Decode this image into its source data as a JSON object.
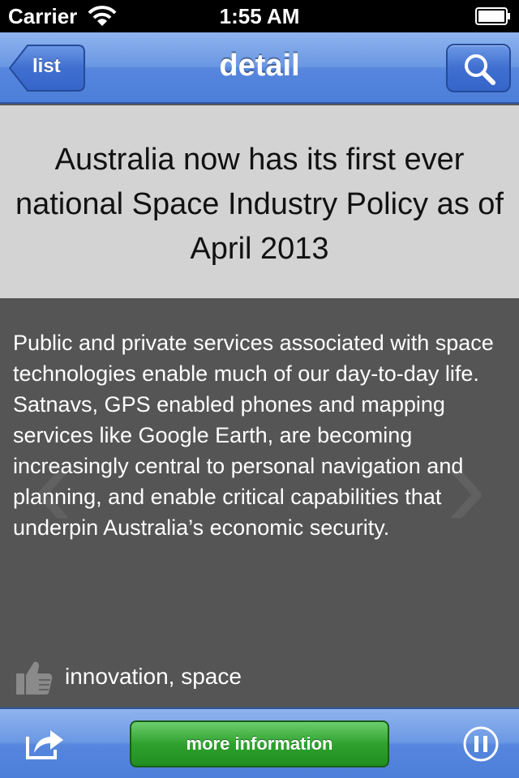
{
  "status_bar": {
    "carrier": "Carrier",
    "time": "1:55 AM"
  },
  "nav_bar": {
    "back_label": "list",
    "title": "detail",
    "search_icon": "search-icon"
  },
  "article": {
    "title": "Australia now has its first ever national Space Industry Policy as of April 2013",
    "body": "Public and private services associated with space technologies enable much of our day-to-day life. Satnavs, GPS enabled phones and mapping services like Google Earth, are becoming increasingly central to personal navigation and planning, and enable critical capabilities that underpin Australia’s economic security.",
    "tags": "innovation, space",
    "prev_glyph": "‹",
    "next_glyph": "›"
  },
  "toolbar": {
    "share_icon": "share-icon",
    "more_info_label": "more information",
    "pause_icon": "pause-icon"
  },
  "colors": {
    "nav_accent": "#4c7fd9",
    "title_bg": "#d3d3d3",
    "body_bg": "#555555",
    "button_green": "#2fa12f"
  }
}
